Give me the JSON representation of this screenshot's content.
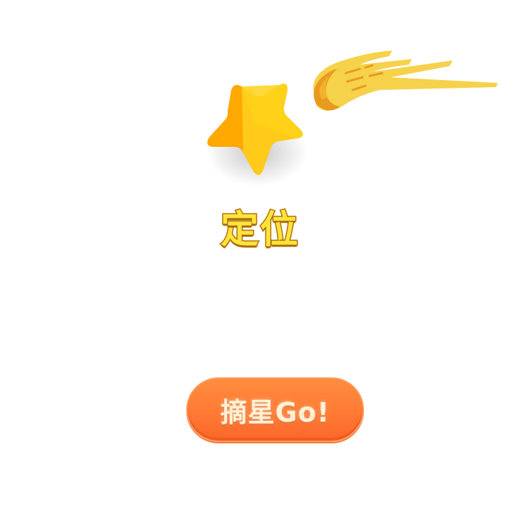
{
  "title": "定位",
  "button": {
    "label": "摘星Go!"
  },
  "icons": {
    "star": "star-icon",
    "comet": "comet-icon"
  },
  "colors": {
    "star_gold": "#ffc107",
    "star_orange": "#ffa000",
    "comet_yellow": "#f6d14a",
    "title_fill": "#ffe43a",
    "title_outline": "#b8760c",
    "button_orange": "#ff7a34"
  }
}
